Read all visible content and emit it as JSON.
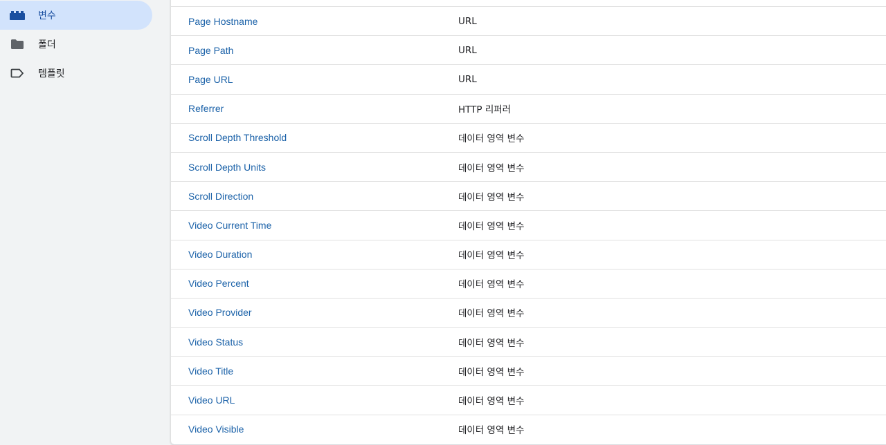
{
  "sidebar": {
    "items": [
      {
        "label": "변수",
        "icon": "variables-blocks-icon",
        "active": true
      },
      {
        "label": "폴더",
        "icon": "folder-icon",
        "active": false
      },
      {
        "label": "템플릿",
        "icon": "tag-label-icon",
        "active": false
      }
    ]
  },
  "colors": {
    "active_bg": "#d2e3fc",
    "link": "#1a61a8",
    "icon_active": "#1a4fa0",
    "icon": "#5f6368"
  },
  "table": {
    "rows": [
      {
        "name": "Page Hostname",
        "type": "URL"
      },
      {
        "name": "Page Path",
        "type": "URL"
      },
      {
        "name": "Page URL",
        "type": "URL"
      },
      {
        "name": "Referrer",
        "type": "HTTP 리퍼러"
      },
      {
        "name": "Scroll Depth Threshold",
        "type": "데이터 영역 변수"
      },
      {
        "name": "Scroll Depth Units",
        "type": "데이터 영역 변수"
      },
      {
        "name": "Scroll Direction",
        "type": "데이터 영역 변수"
      },
      {
        "name": "Video Current Time",
        "type": "데이터 영역 변수"
      },
      {
        "name": "Video Duration",
        "type": "데이터 영역 변수"
      },
      {
        "name": "Video Percent",
        "type": "데이터 영역 변수"
      },
      {
        "name": "Video Provider",
        "type": "데이터 영역 변수"
      },
      {
        "name": "Video Status",
        "type": "데이터 영역 변수"
      },
      {
        "name": "Video Title",
        "type": "데이터 영역 변수"
      },
      {
        "name": "Video URL",
        "type": "데이터 영역 변수"
      },
      {
        "name": "Video Visible",
        "type": "데이터 영역 변수"
      }
    ]
  }
}
